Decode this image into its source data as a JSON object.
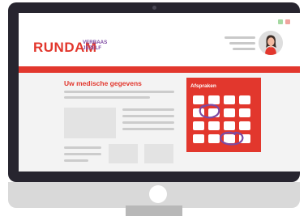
{
  "brand": {
    "name": "RUNDAM",
    "tagline_line1": "VERBAAS",
    "tagline_line2": "JEZELF"
  },
  "page": {
    "title": "Uw medische gegevens"
  },
  "appointments_card": {
    "label": "Afspraken"
  },
  "colors": {
    "accent_red": "#e2372d",
    "accent_purple": "#7d4aa2",
    "monitor_dark": "#27252f"
  }
}
